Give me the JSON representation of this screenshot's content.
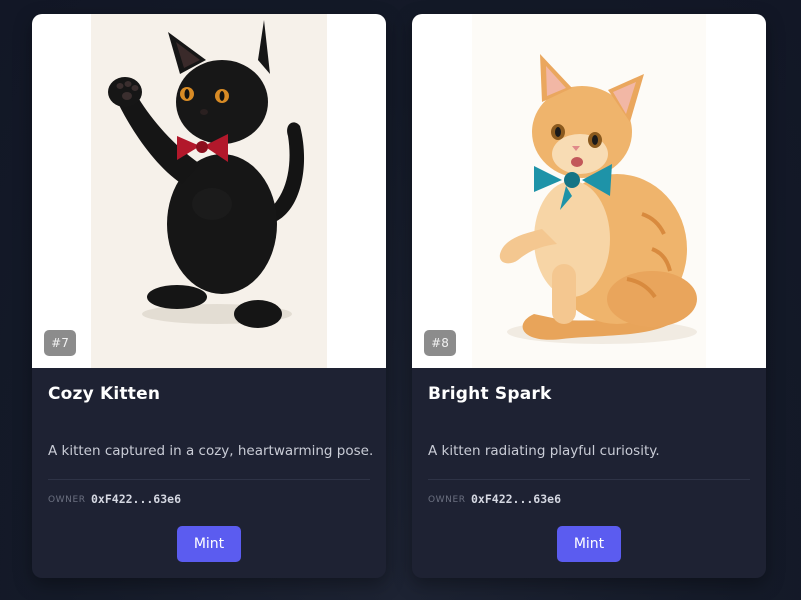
{
  "cards": [
    {
      "id_badge": "#7",
      "title": "Cozy Kitten",
      "description": "A kitten captured in a cozy, heartwarming pose.",
      "owner_label": "OWNER",
      "owner_address": "0xF422...63e6",
      "mint_label": "Mint",
      "image_icon": "black-kitten-red-bowtie-image"
    },
    {
      "id_badge": "#8",
      "title": "Bright Spark",
      "description": "A kitten radiating playful curiosity.",
      "owner_label": "OWNER",
      "owner_address": "0xF422...63e6",
      "mint_label": "Mint",
      "image_icon": "orange-kitten-teal-bowtie-image"
    }
  ],
  "colors": {
    "background": "#141a28",
    "card": "#1e2233",
    "accent": "#5b5cf0",
    "divider": "#2e3346"
  }
}
